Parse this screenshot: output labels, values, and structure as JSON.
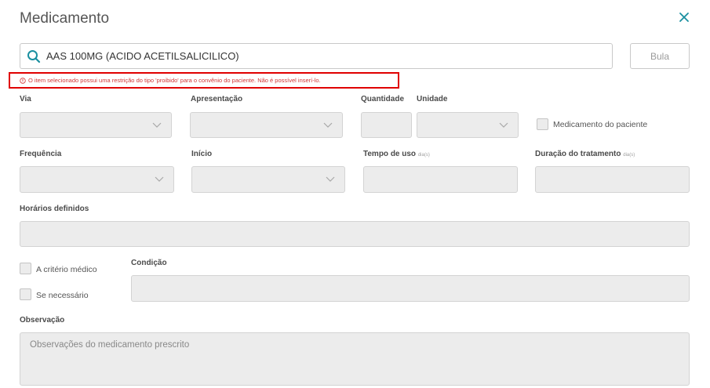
{
  "header": {
    "title": "Medicamento"
  },
  "search": {
    "value": "AAS 100MG (ACIDO ACETILSALICILICO)"
  },
  "bula_button": "Bula",
  "alert": {
    "message": "O item selecionado possui uma restrição do tipo 'proibido' para o convênio do paciente. Não é possível inserí-lo."
  },
  "labels": {
    "via": "Via",
    "apresentacao": "Apresentação",
    "quantidade": "Quantidade",
    "unidade": "Unidade",
    "medicamento_paciente": "Medicamento do paciente",
    "frequencia": "Frequência",
    "inicio": "Início",
    "tempo_uso": "Tempo de uso",
    "tempo_uso_unit": "dia(s)",
    "duracao": "Duração do tratamento",
    "duracao_unit": "dia(s)",
    "horarios": "Horários definidos",
    "criterio_medico": "A critério médico",
    "condicao": "Condição",
    "se_necessario": "Se necessário",
    "observacao": "Observação"
  },
  "observacao": {
    "placeholder": "Observações do medicamento prescrito"
  },
  "icons": {
    "search": "search-icon",
    "close": "close-icon",
    "chevron": "chevron-down-icon",
    "alert": "info-circle-icon"
  },
  "colors": {
    "accent": "#1a8fa0",
    "alert": "#e00000",
    "field_bg": "#ececec"
  }
}
